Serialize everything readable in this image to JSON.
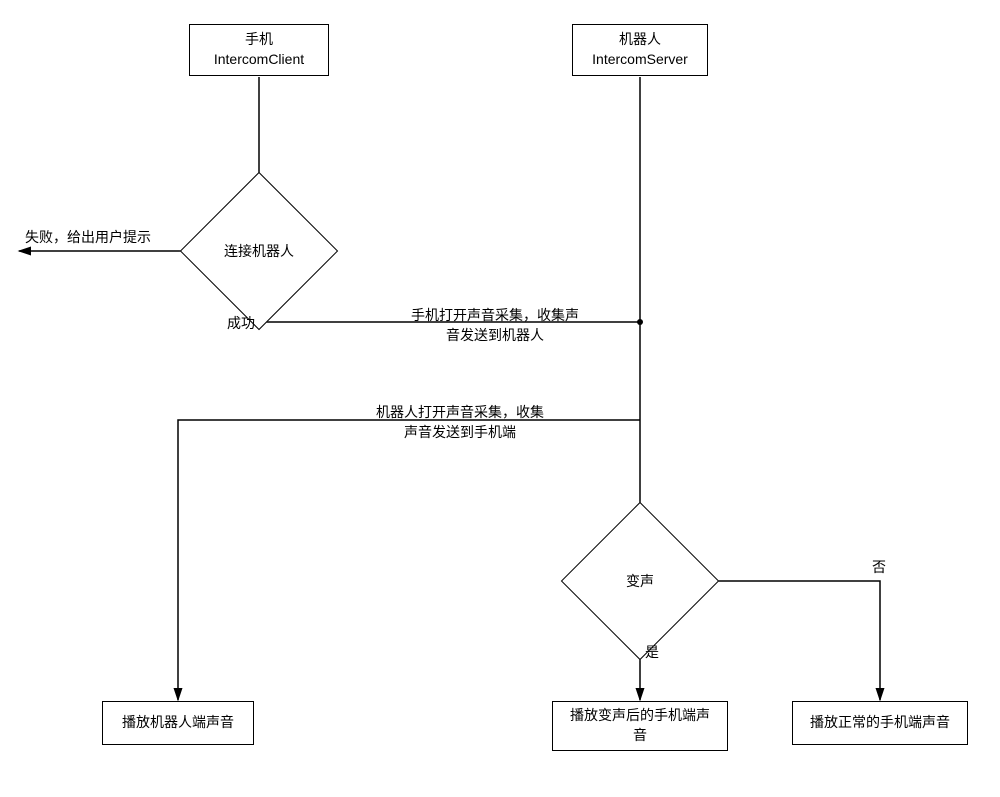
{
  "nodes": {
    "phone_client": {
      "line1": "手机",
      "line2": "IntercomClient"
    },
    "robot_server": {
      "line1": "机器人",
      "line2": "IntercomServer"
    },
    "connect_robot": "连接机器人",
    "voice_change": "变声",
    "play_robot_sound": "播放机器人端声音",
    "play_changed_sound": "播放变声后的手机端声\n音",
    "play_normal_sound": "播放正常的手机端声音"
  },
  "labels": {
    "fail_hint": "失败，给出用户提示",
    "success": "成功",
    "phone_collect": "手机打开声音采集，收集声\n音发送到机器人",
    "robot_collect": "机器人打开声音采集，收集\n声音发送到手机端",
    "yes": "是",
    "no": "否"
  }
}
